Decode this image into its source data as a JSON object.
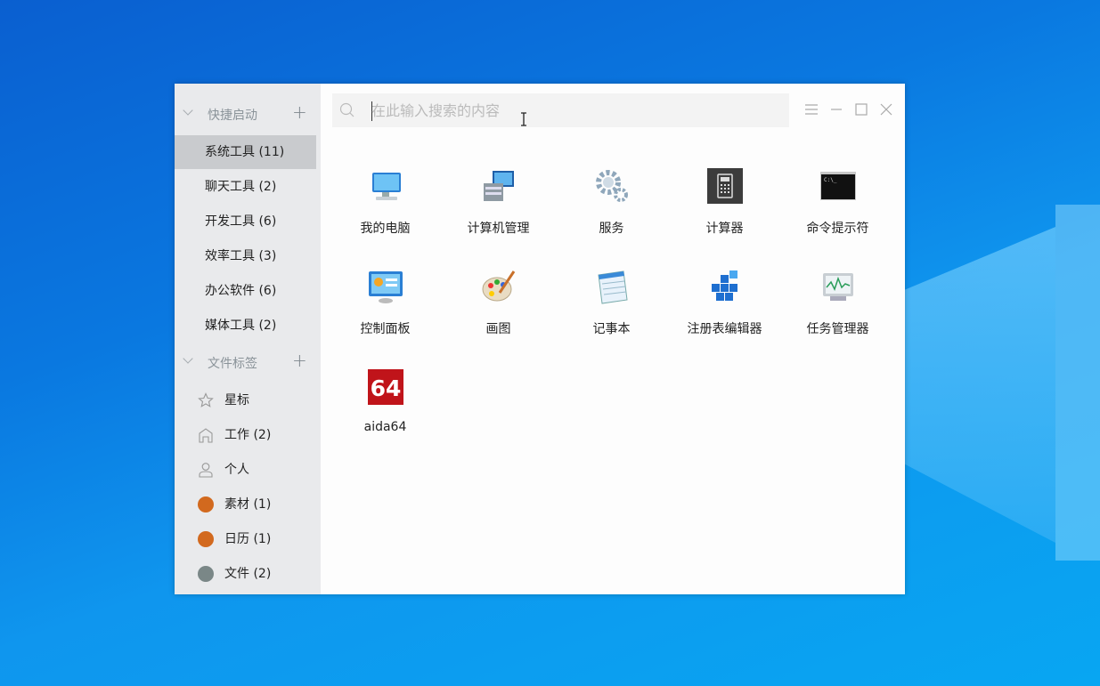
{
  "sidebar": {
    "quick_launch": {
      "title": "快捷启动",
      "items": [
        {
          "label": "系统工具 (11)",
          "selected": true
        },
        {
          "label": "聊天工具 (2)"
        },
        {
          "label": "开发工具 (6)"
        },
        {
          "label": "效率工具 (3)"
        },
        {
          "label": "办公软件 (6)"
        },
        {
          "label": "媒体工具 (2)"
        }
      ]
    },
    "file_tags": {
      "title": "文件标签",
      "items": [
        {
          "label": "星标",
          "icon": "star-icon"
        },
        {
          "label": "工作 (2)",
          "icon": "home-icon"
        },
        {
          "label": "个人",
          "icon": "user-icon"
        },
        {
          "label": "素材 (1)",
          "color": "#d2691e"
        },
        {
          "label": "日历 (1)",
          "color": "#d2691e"
        },
        {
          "label": "文件 (2)",
          "color": "#7a8787"
        }
      ]
    }
  },
  "search": {
    "placeholder": "在此输入搜索的内容",
    "value": ""
  },
  "apps": [
    {
      "name": "我的电脑",
      "icon": "computer-icon"
    },
    {
      "name": "计算机管理",
      "icon": "computer-management-icon"
    },
    {
      "name": "服务",
      "icon": "gears-icon"
    },
    {
      "name": "计算器",
      "icon": "calculator-icon"
    },
    {
      "name": "命令提示符",
      "icon": "terminal-icon"
    },
    {
      "name": "控制面板",
      "icon": "control-panel-icon"
    },
    {
      "name": "画图",
      "icon": "palette-icon"
    },
    {
      "name": "记事本",
      "icon": "notepad-icon"
    },
    {
      "name": "注册表编辑器",
      "icon": "registry-icon"
    },
    {
      "name": "任务管理器",
      "icon": "task-manager-icon"
    },
    {
      "name": "aida64",
      "icon": "aida64-icon",
      "logo_text": "64"
    }
  ],
  "colors": {
    "accent_orange": "#d2691e",
    "tag_gray": "#7a8787"
  }
}
